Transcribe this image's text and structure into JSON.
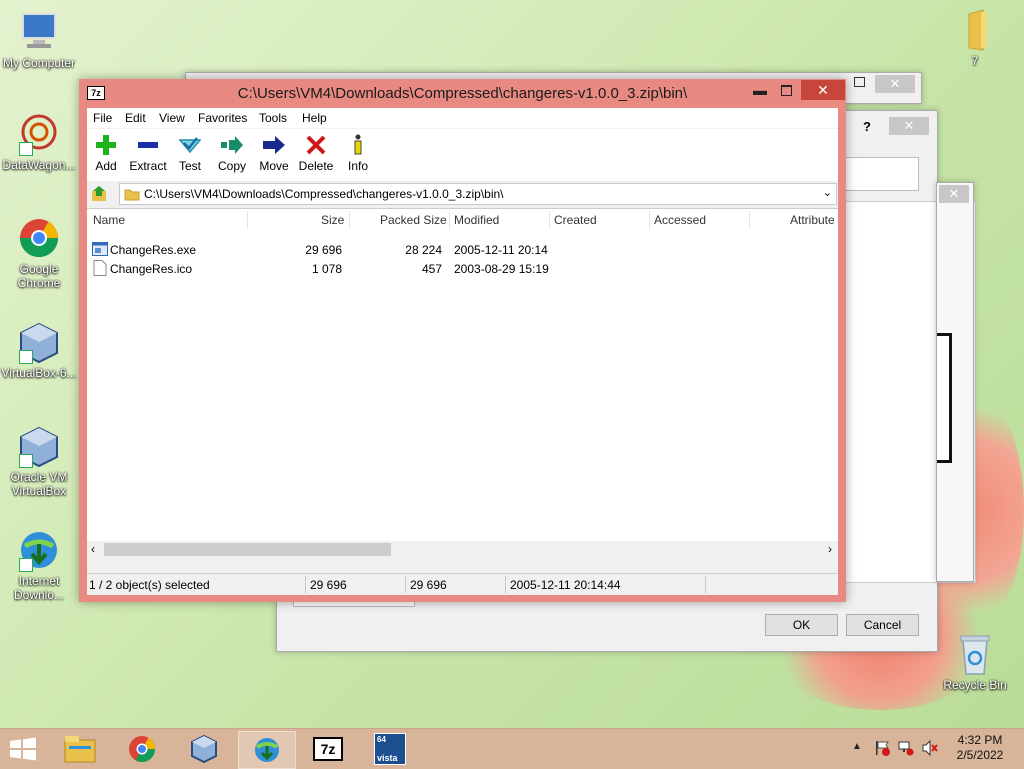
{
  "desktop": {
    "icons": [
      {
        "label": "My Computer"
      },
      {
        "label": "DataWagon..."
      },
      {
        "label": "Google Chrome"
      },
      {
        "label": "VirtualBox-6..."
      },
      {
        "label": "Oracle VM VirtualBox"
      },
      {
        "label": "Internet Downlo..."
      },
      {
        "label": "7"
      },
      {
        "label": "Recycle Bin"
      }
    ]
  },
  "background_dialog": {
    "ok_label": "OK",
    "cancel_label": "Cancel",
    "help_label": "?"
  },
  "window": {
    "title": "C:\\Users\\VM4\\Downloads\\Compressed\\changeres-v1.0.0_3.zip\\bin\\",
    "app_icon_text": "7z",
    "menu": [
      "File",
      "Edit",
      "View",
      "Favorites",
      "Tools",
      "Help"
    ],
    "toolbar": [
      {
        "label": "Add",
        "icon": "plus-icon",
        "color": "#1db31d"
      },
      {
        "label": "Extract",
        "icon": "minus-icon",
        "color": "#1a2fa8"
      },
      {
        "label": "Test",
        "icon": "check-icon",
        "color": "#2aa8c8"
      },
      {
        "label": "Copy",
        "icon": "copy-arrow-icon",
        "color": "#1a8c6a"
      },
      {
        "label": "Move",
        "icon": "move-arrow-icon",
        "color": "#1a2a8c"
      },
      {
        "label": "Delete",
        "icon": "delete-x-icon",
        "color": "#d01818"
      },
      {
        "label": "Info",
        "icon": "info-icon",
        "color": "#d4c000"
      }
    ],
    "address": "C:\\Users\\VM4\\Downloads\\Compressed\\changeres-v1.0.0_3.zip\\bin\\",
    "columns": [
      "Name",
      "Size",
      "Packed Size",
      "Modified",
      "Created",
      "Accessed",
      "Attribute"
    ],
    "files": [
      {
        "name": "ChangeRes.exe",
        "size": "29 696",
        "packed": "28 224",
        "modified": "2005-12-11 20:14",
        "icon": "exe-file-icon"
      },
      {
        "name": "ChangeRes.ico",
        "size": "1 078",
        "packed": "457",
        "modified": "2003-08-29 15:19",
        "icon": "blank-file-icon"
      }
    ],
    "status": {
      "selection": "1 / 2 object(s) selected",
      "size": "29 696",
      "packed": "29 696",
      "modified": "2005-12-11 20:14:44"
    }
  },
  "taskbar": {
    "time": "4:32 PM",
    "date": "2/5/2022",
    "apps": [
      "File Explorer",
      "Google Chrome",
      "VirtualBox",
      "Internet Download Manager",
      "7-Zip",
      "Vista"
    ],
    "seven_zip_label": "7z",
    "vista_label": "vista",
    "vista_badge": "64"
  }
}
